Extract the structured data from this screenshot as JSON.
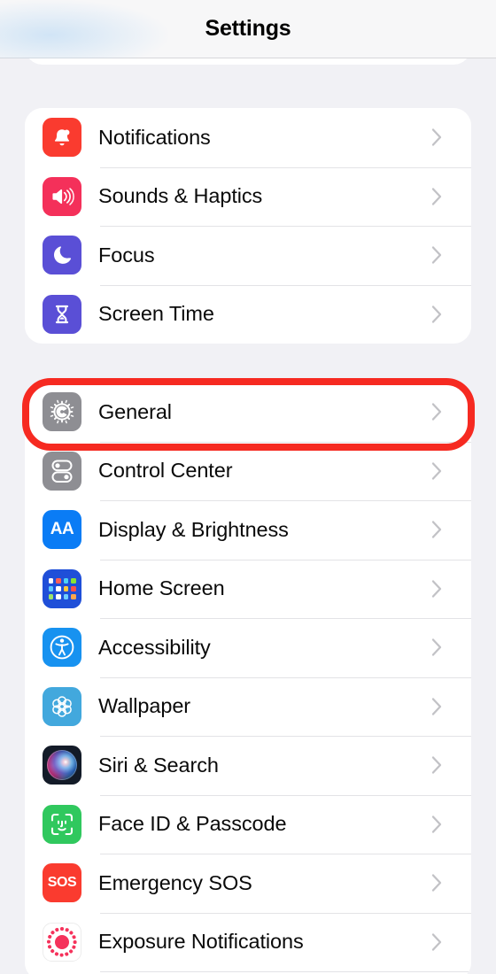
{
  "header": {
    "title": "Settings"
  },
  "colors": {
    "page_background": "#f1f1f5",
    "card_background": "#ffffff",
    "separator": "#e3e3e6",
    "label_text": "#0a0a0a",
    "chevron": "#c2c2c6",
    "highlight_outline": "#f62a21"
  },
  "annotation": {
    "type": "rounded-rectangle-highlight",
    "color": "#f62a21",
    "target_row": "General"
  },
  "groups": [
    {
      "name": "alerts-group",
      "rows": [
        {
          "label": "Notifications",
          "icon": "notifications-bell-icon",
          "icon_color": "#fa3b2f",
          "accessory": "chevron-right-icon"
        },
        {
          "label": "Sounds & Haptics",
          "icon": "speaker-waves-icon",
          "icon_color": "#f4305a",
          "accessory": "chevron-right-icon"
        },
        {
          "label": "Focus",
          "icon": "moon-icon",
          "icon_color": "#5a4fd6",
          "accessory": "chevron-right-icon"
        },
        {
          "label": "Screen Time",
          "icon": "hourglass-icon",
          "icon_color": "#5a4fd6",
          "accessory": "chevron-right-icon"
        }
      ]
    },
    {
      "name": "system-group",
      "rows": [
        {
          "label": "General",
          "icon": "gear-icon",
          "icon_color": "#8e8e93",
          "accessory": "chevron-right-icon",
          "highlighted": true
        },
        {
          "label": "Control Center",
          "icon": "toggles-icon",
          "icon_color": "#8e8e93",
          "accessory": "chevron-right-icon"
        },
        {
          "label": "Display & Brightness",
          "icon": "display-aa-icon",
          "icon_color": "#0a7cf5",
          "accessory": "chevron-right-icon"
        },
        {
          "label": "Home Screen",
          "icon": "home-screen-grid-icon",
          "icon_color": "#1f4fd8",
          "accessory": "chevron-right-icon"
        },
        {
          "label": "Accessibility",
          "icon": "accessibility-person-icon",
          "icon_color": "#1792f0",
          "accessory": "chevron-right-icon"
        },
        {
          "label": "Wallpaper",
          "icon": "wallpaper-flower-icon",
          "icon_color": "#42a8dd",
          "accessory": "chevron-right-icon"
        },
        {
          "label": "Siri & Search",
          "icon": "siri-orb-icon",
          "icon_color": "#131b28",
          "accessory": "chevron-right-icon"
        },
        {
          "label": "Face ID & Passcode",
          "icon": "face-id-icon",
          "icon_color": "#30c85e",
          "accessory": "chevron-right-icon"
        },
        {
          "label": "Emergency SOS",
          "icon": "sos-icon",
          "icon_text": "SOS",
          "icon_color": "#fa3b2f",
          "accessory": "chevron-right-icon"
        },
        {
          "label": "Exposure Notifications",
          "icon": "exposure-notifications-icon",
          "icon_color": "#f5325b",
          "accessory": "chevron-right-icon"
        }
      ]
    }
  ],
  "icon_glyphs": {
    "display_aa": "AA",
    "sos": "SOS"
  }
}
